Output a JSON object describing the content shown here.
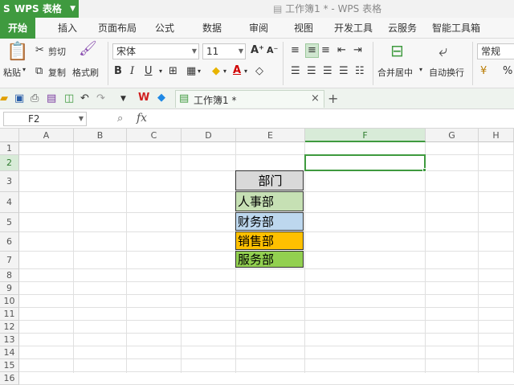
{
  "app": {
    "name": "WPS 表格",
    "window_title": "工作簿1 * - WPS 表格",
    "brand_color": "#3f9a3f"
  },
  "ribbon_tabs": [
    {
      "label": "开始",
      "active": true
    },
    {
      "label": "插入"
    },
    {
      "label": "页面布局"
    },
    {
      "label": "公式"
    },
    {
      "label": "数据"
    },
    {
      "label": "审阅"
    },
    {
      "label": "视图"
    },
    {
      "label": "开发工具"
    },
    {
      "label": "云服务"
    },
    {
      "label": "智能工具箱"
    }
  ],
  "ribbon": {
    "paste": "粘贴",
    "cut": "剪切",
    "copy": "复制",
    "format_painter": "格式刷",
    "font_name": "宋体",
    "font_size": "11",
    "merge_center": "合并居中",
    "wrap_text": "自动换行",
    "number_format": "常规"
  },
  "quickbar": {
    "sheet_tab": "工作簿1 *",
    "close": "×",
    "add": "+"
  },
  "formula_bar": {
    "name_box": "F2",
    "fx": "fx",
    "content": ""
  },
  "columns": [
    "A",
    "B",
    "C",
    "D",
    "E",
    "F",
    "G",
    "H"
  ],
  "rows": [
    "1",
    "2",
    "3",
    "4",
    "5",
    "6",
    "7",
    "8",
    "9",
    "10",
    "11",
    "12",
    "13",
    "14",
    "15",
    "16"
  ],
  "active_cell": "F2",
  "cells": [
    {
      "ref": "E3",
      "value": "部门",
      "fill": "#d9d9d9"
    },
    {
      "ref": "E4",
      "value": "人事部",
      "fill": "#c6e0b4"
    },
    {
      "ref": "E5",
      "value": "财务部",
      "fill": "#bdd7ee"
    },
    {
      "ref": "E6",
      "value": "销售部",
      "fill": "#ffc000"
    },
    {
      "ref": "E7",
      "value": "服务部",
      "fill": "#92d050"
    }
  ]
}
